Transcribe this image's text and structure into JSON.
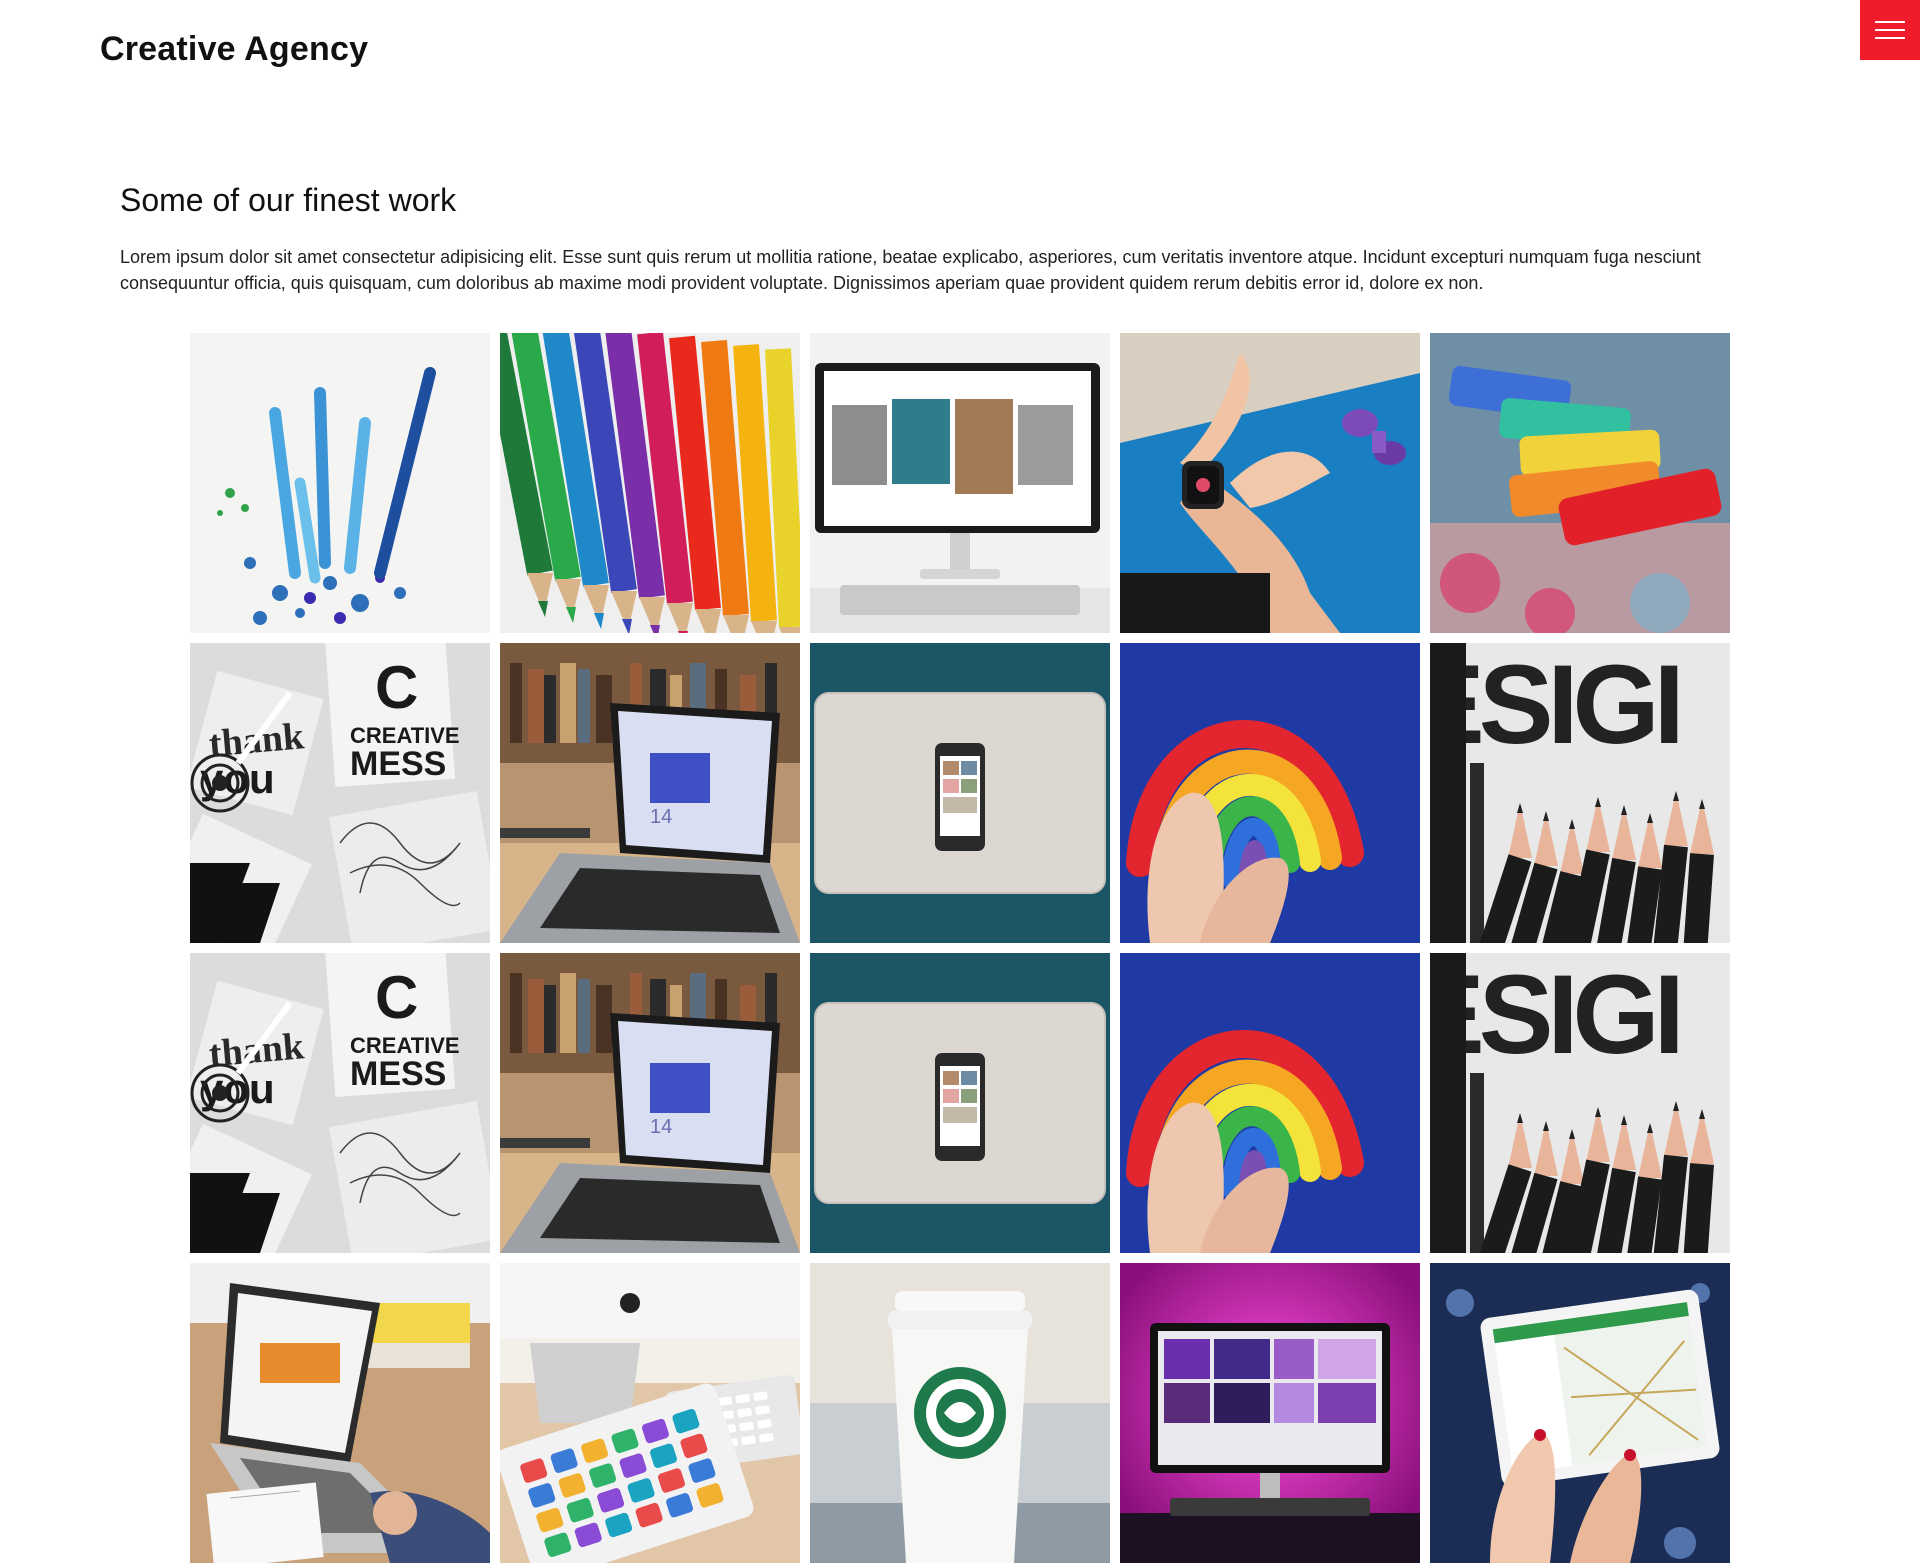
{
  "header": {
    "brand": "Creative Agency",
    "menu_icon": "hamburger-icon"
  },
  "section": {
    "title": "Some of our finest work",
    "text": "Lorem ipsum dolor sit amet consectetur adipisicing elit. Esse sunt quis rerum ut mollitia ratione, beatae explicabo, asperiores, cum veritatis inventore atque. Incidunt excepturi numquam fuga nesciunt consequuntur officia, quis quisquam, cum doloribus ab maxime modi provident voluptate. Dignissimos aperiam quae provident quidem rerum debitis error id, dolore ex non."
  },
  "colors": {
    "accent": "#f01c2c",
    "text": "#111111",
    "background": "#ffffff"
  },
  "gallery": {
    "images": [
      {
        "subject": "pencils-shavings",
        "image_text": ""
      },
      {
        "subject": "colored-pencils",
        "image_text": ""
      },
      {
        "subject": "monitor-gallery",
        "image_text": ""
      },
      {
        "subject": "smartwatch-fitness",
        "image_text": ""
      },
      {
        "subject": "colored-chalk",
        "image_text": ""
      },
      {
        "subject": "creative-mess",
        "image_text": "CREATIVE MESS"
      },
      {
        "subject": "laptop-shelf",
        "image_text": ""
      },
      {
        "subject": "phone-on-laptop",
        "image_text": ""
      },
      {
        "subject": "clay-rainbow",
        "image_text": ""
      },
      {
        "subject": "design-pencils",
        "image_text": "ESIGI"
      },
      {
        "subject": "creative-mess",
        "image_text": "CREATIVE MESS"
      },
      {
        "subject": "laptop-shelf",
        "image_text": ""
      },
      {
        "subject": "phone-on-laptop",
        "image_text": ""
      },
      {
        "subject": "clay-rainbow",
        "image_text": ""
      },
      {
        "subject": "design-pencils",
        "image_text": "ESIGI"
      },
      {
        "subject": "laptop-desk",
        "image_text": ""
      },
      {
        "subject": "imac-ipad",
        "image_text": ""
      },
      {
        "subject": "coffee-cup",
        "image_text": ""
      },
      {
        "subject": "pink-monitor",
        "image_text": ""
      },
      {
        "subject": "tablet-map",
        "image_text": ""
      }
    ]
  }
}
